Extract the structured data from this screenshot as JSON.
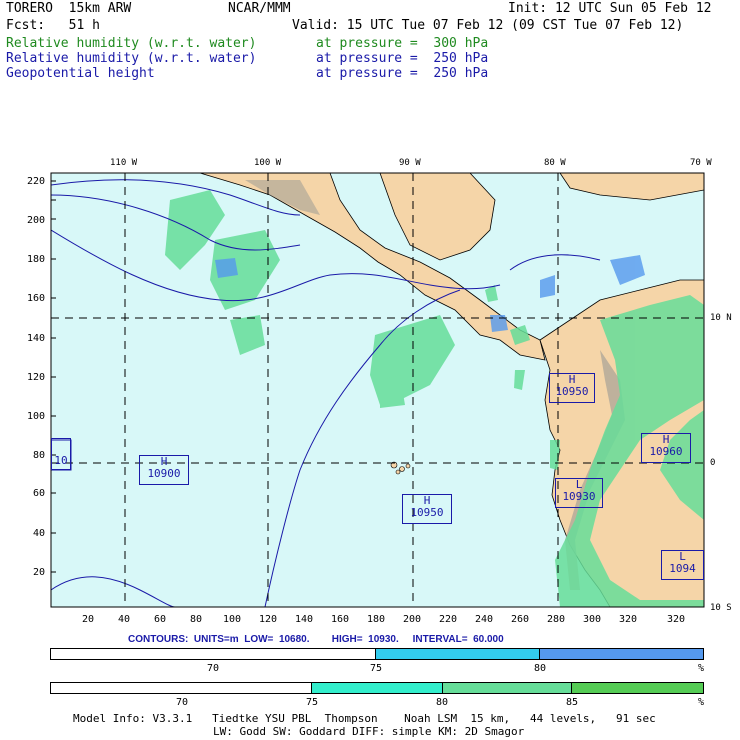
{
  "header": {
    "model": "TORERO  15km ARW",
    "org": "NCAR/MMM",
    "init": "Init: 12 UTC Sun 05 Feb 12",
    "fcst": "Fcst:   51 h",
    "valid": "Valid: 15 UTC Tue 07 Feb 12 (09 CST Tue 07 Feb 12)",
    "fields": [
      {
        "name": "Relative humidity (w.r.t. water)",
        "level": "at pressure =  300 hPa",
        "color": "#1f8a1f"
      },
      {
        "name": "Relative humidity (w.r.t. water)",
        "level": "at pressure =  250 hPa",
        "color": "#1a1aa8"
      },
      {
        "name": "Geopotential height",
        "level": "at pressure =  250 hPa",
        "color": "#1a1aa8"
      }
    ]
  },
  "map": {
    "lon_labels": [
      "110 W",
      "100 W",
      "90 W",
      "80 W",
      "70 W"
    ],
    "lat_labels": [
      "10 N",
      "0",
      "10 S"
    ],
    "y_ticks": [
      "220",
      "200",
      "180",
      "160",
      "140",
      "120",
      "100",
      "80",
      "60",
      "40",
      "20"
    ],
    "x_ticks": [
      "20",
      "40",
      "60",
      "80",
      "100",
      "120",
      "140",
      "160",
      "180",
      "200",
      "220",
      "240",
      "260",
      "280",
      "300",
      "320"
    ],
    "colors": {
      "ocean": "#d8f8f8",
      "land": "#f5d5a8",
      "terrain": "#b0a898",
      "rh_green": "#66dd99",
      "rh_blue": "#5599ee",
      "contour": "#1a1aa8"
    },
    "highs_lows": [
      {
        "kind": "L",
        "value": "10"
      },
      {
        "kind": "H",
        "value": "10900"
      },
      {
        "kind": "H",
        "value": "10950"
      },
      {
        "kind": "H",
        "value": "10950"
      },
      {
        "kind": "H",
        "value": "10960"
      },
      {
        "kind": "L",
        "value": "10930"
      },
      {
        "kind": "L",
        "value": "1094"
      }
    ]
  },
  "contours_line": "CONTOURS:  UNITS=m  LOW=  10680.        HIGH=  10930.     INTERVAL=  60.000",
  "colorbar_blue": {
    "labels": [
      "70",
      "75",
      "80"
    ],
    "unit": "%",
    "colors": [
      "#ffffff",
      "#33ccee",
      "#5599ee"
    ]
  },
  "colorbar_green": {
    "labels": [
      "70",
      "75",
      "80",
      "85"
    ],
    "unit": "%",
    "colors": [
      "#ffffff",
      "#33eecc",
      "#66dd99",
      "#55cc55"
    ]
  },
  "footer": {
    "line1": "Model Info: V3.3.1   Tiedtke YSU PBL  Thompson    Noah LSM  15 km,   44 levels,   91 sec",
    "line2": "LW: Godd SW: Goddard DIFF: simple KM: 2D Smagor"
  }
}
